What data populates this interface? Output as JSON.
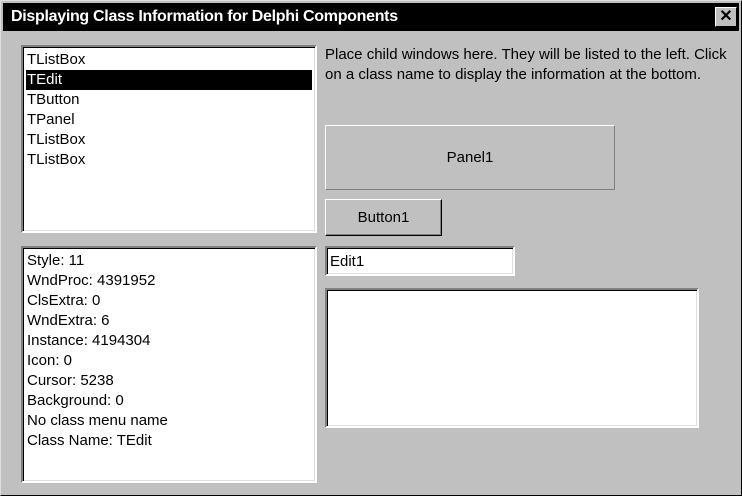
{
  "window": {
    "title": "Displaying Class Information for Delphi Components",
    "close_label": "✕"
  },
  "class_list": {
    "items": [
      "TListBox",
      "TEdit",
      "TButton",
      "TPanel",
      "TListBox",
      "TListBox"
    ],
    "selected_index": 1
  },
  "class_info": {
    "lines": [
      "Style: 11",
      "WndProc: 4391952",
      "ClsExtra: 0",
      "WndExtra: 6",
      "Instance: 4194304",
      "Icon: 0",
      "Cursor: 5238",
      "Background: 0",
      "No class menu name",
      "Class Name: TEdit"
    ]
  },
  "instructions": {
    "text": "Place child windows here.  They will be listed to the left.  Click on a class name to display the information at the bottom."
  },
  "panel1": {
    "caption": "Panel1"
  },
  "button1": {
    "caption": "Button1"
  },
  "edit1": {
    "value": "Edit1"
  },
  "memo": {
    "value": ""
  },
  "colors": {
    "face": "#c0c0c0",
    "selection": "#000000",
    "titlebar": "#000000"
  }
}
